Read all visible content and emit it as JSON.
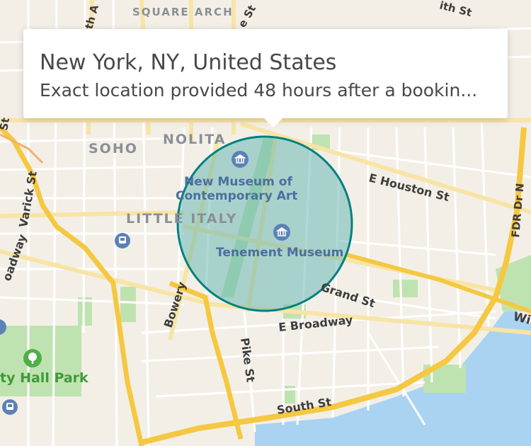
{
  "callout": {
    "title": "New York, NY, United States",
    "subtitle": "Exact location provided 48 hours after a bookin..."
  },
  "map": {
    "districts": [
      "SQUARE ARCH",
      "NOLITA",
      "SOHO",
      "LITTLE ITALY"
    ],
    "streets": [
      "E Houston St",
      "Varick St",
      "Bowery",
      "Grand St",
      "E Broadway",
      "Pike St",
      "South St",
      "FDR Dr N",
      "Wil",
      "oadway",
      "ith St",
      "th A",
      "St",
      "e St"
    ],
    "pois": [
      "New Museum of",
      "Contemporary Art",
      "Tenement Museum"
    ],
    "parks": [
      "ty Hall Park"
    ],
    "icons": [
      "museum-icon",
      "subway-icon",
      "park-icon"
    ],
    "colors": {
      "background": "#f3efe6",
      "water": "#a9d3f0",
      "park": "#bfe3b0",
      "highway": "#f5c842",
      "radius_fill": "#5fb3b0",
      "radius_stroke": "#008080"
    }
  }
}
